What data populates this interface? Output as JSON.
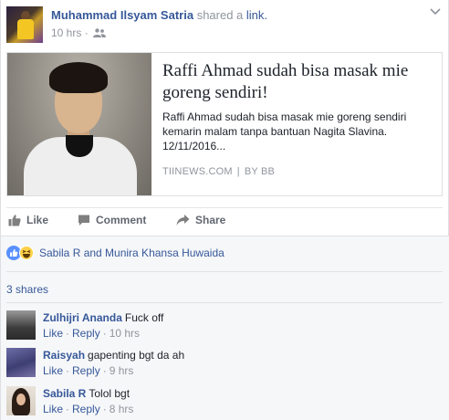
{
  "post": {
    "author": "Muhammad Ilsyam Satria",
    "verb": "shared a",
    "link_word": "link.",
    "time": "10 hrs",
    "meta_sep": "·",
    "audience_icon": "friends-icon",
    "menu_icon": "chevron-down-icon"
  },
  "link_card": {
    "title": "Raffi Ahmad sudah bisa masak mie goreng sendiri!",
    "description": "Raffi Ahmad sudah bisa masak mie goreng sendiri kemarin malam tanpa bantuan Nagita Slavina. 12/11/2016...",
    "domain": "TIINEWS.COM",
    "separator": "|",
    "byline": "BY BB"
  },
  "actions": {
    "like": "Like",
    "comment": "Comment",
    "share": "Share"
  },
  "reactions": {
    "icons": [
      "like-reaction-icon",
      "haha-reaction-icon"
    ],
    "names": "Sabila R and Munira Khansa Huwaida"
  },
  "shares_label": "3 shares",
  "comments": [
    {
      "name": "Zulhijri Ananda",
      "text": "Fuck off",
      "like": "Like",
      "reply": "Reply",
      "time": "10 hrs"
    },
    {
      "name": "Raisyah",
      "text": "gapenting bgt da ah",
      "like": "Like",
      "reply": "Reply",
      "time": "9 hrs"
    },
    {
      "name": "Sabila R",
      "text": "Tolol bgt",
      "like": "Like",
      "reply": "Reply",
      "time": "8 hrs"
    }
  ],
  "meta_dot": "·",
  "colors": {
    "link_blue": "#365899",
    "muted_gray": "#90949c",
    "like_blue": "#5890ff",
    "haha_yellow": "#fdd049"
  }
}
